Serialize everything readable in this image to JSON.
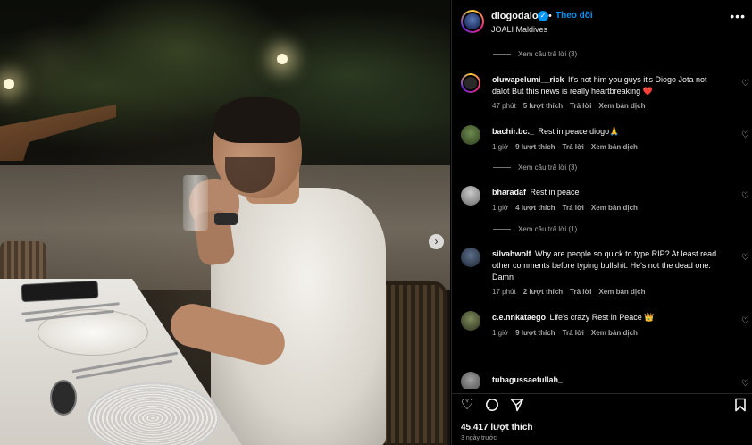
{
  "post": {
    "username": "diogodalot",
    "separator": "•",
    "follow_label": "Theo dõi",
    "location": "JOALI Maldives",
    "more_label": "•••",
    "likes": "45.417 lượt thích",
    "date": "3 ngày trước"
  },
  "colors": {
    "accent": "#0095f6",
    "background": "#000000",
    "muted_text": "#a8a8a8",
    "heart_red": "#ed4956"
  },
  "comments": [
    {
      "type": "replies",
      "label": "Xem câu trả lời (3)"
    },
    {
      "type": "comment",
      "username": "oluwapelumi__rick",
      "text": "It's not him you guys it's Diogo Jota not dalot But this news is really heartbreaking",
      "emoji": "❤️",
      "time": "47 phút",
      "likes": "5 lượt thích",
      "reply": "Trả lời",
      "translate": "Xem bản dịch"
    },
    {
      "type": "comment",
      "username": "bachir.bc._",
      "text": "Rest in peace diogo",
      "emoji": "🙏",
      "time": "1 giờ",
      "likes": "9 lượt thích",
      "reply": "Trả lời",
      "translate": "Xem bản dịch"
    },
    {
      "type": "replies",
      "label": "Xem câu trả lời (3)"
    },
    {
      "type": "comment",
      "username": "bharadaf",
      "text": "Rest in peace",
      "emoji": "",
      "time": "1 giờ",
      "likes": "4 lượt thích",
      "reply": "Trả lời",
      "translate": "Xem bản dịch"
    },
    {
      "type": "replies",
      "label": "Xem câu trả lời (1)"
    },
    {
      "type": "comment",
      "username": "silvahwolf",
      "text": "Why are people so quick to type RIP? At least read other comments before typing bullshit. He's not the dead one. Damn",
      "emoji": "",
      "time": "17 phút",
      "likes": "2 lượt thích",
      "reply": "Trả lời",
      "translate": "Xem bản dịch"
    },
    {
      "type": "comment",
      "username": "c.e.nnkataego",
      "text": "Life's crazy Rest in Peace",
      "emoji": "👑",
      "time": "1 giờ",
      "likes": "9 lượt thích",
      "reply": "Trả lời",
      "translate": "Xem bản dịch"
    },
    {
      "type": "comment",
      "username": "tubagussaefullah_",
      "text": "",
      "emoji": "",
      "time": "",
      "likes": "",
      "reply": "",
      "translate": ""
    }
  ],
  "icons": {
    "like": "heart-outline-icon",
    "comment": "comment-bubble-icon",
    "share": "paper-plane-icon",
    "save": "bookmark-icon",
    "comment_like": "small-heart-icon",
    "next": "chevron-right-icon"
  }
}
